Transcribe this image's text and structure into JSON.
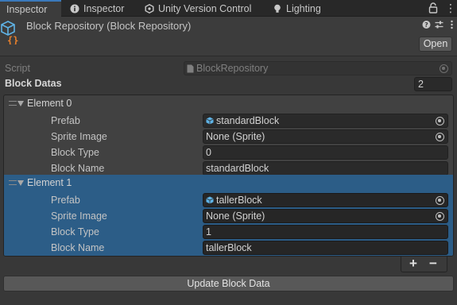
{
  "tabs": [
    {
      "label": "Inspector",
      "icon": "info-icon"
    },
    {
      "label": "Inspector",
      "icon": "info-icon"
    },
    {
      "label": "Unity Version Control",
      "icon": "version-control-icon"
    },
    {
      "label": "Lighting",
      "icon": "lightbulb-icon"
    }
  ],
  "header": {
    "title": "Block Repository (Block Repository)",
    "open_label": "Open"
  },
  "script": {
    "label": "Script",
    "value": "BlockRepository"
  },
  "block_datas": {
    "label": "Block Datas",
    "count": "2",
    "elements": [
      {
        "title": "Element 0",
        "prefab_label": "Prefab",
        "prefab_value": "standardBlock",
        "sprite_label": "Sprite Image",
        "sprite_value": "None (Sprite)",
        "type_label": "Block Type",
        "type_value": "0",
        "name_label": "Block Name",
        "name_value": "standardBlock"
      },
      {
        "title": "Element 1",
        "prefab_label": "Prefab",
        "prefab_value": "tallerBlock",
        "sprite_label": "Sprite Image",
        "sprite_value": "None (Sprite)",
        "type_label": "Block Type",
        "type_value": "1",
        "name_label": "Block Name",
        "name_value": "tallerBlock"
      }
    ],
    "plus": "+",
    "minus": "−"
  },
  "update_button": "Update Block Data",
  "colors": {
    "background": "#383838",
    "selection": "#2c5d87",
    "accent": "#3a79bb",
    "prefab_icon": "#5fb3e6",
    "script_icon_orange": "#e8802c"
  }
}
